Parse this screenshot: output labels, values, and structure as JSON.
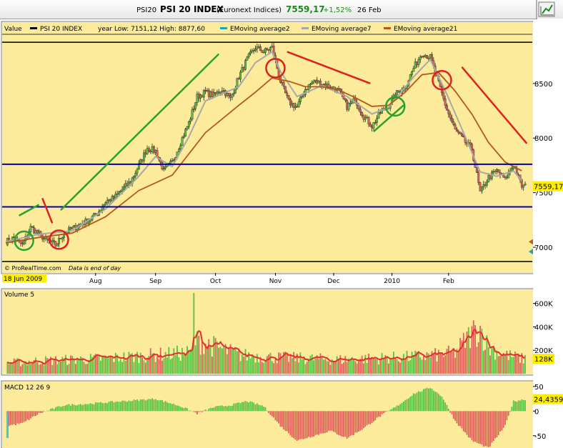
{
  "header": {
    "symbol": "PSI20",
    "name": "PSI 20 INDEX",
    "exchange": "(Euronext Indices)",
    "price": "7559,17",
    "change": "+1,52%",
    "date": "26 Feb"
  },
  "legend": {
    "value_label": "Value",
    "items": [
      {
        "label": "PSI 20 INDEX",
        "color": "#000000"
      },
      {
        "label": "year Low: 7151,12 High: 8877,60",
        "color": null
      },
      {
        "label": "EMoving average2",
        "color": "#1aa7b5"
      },
      {
        "label": "EMoving average7",
        "color": "#a8a8a8"
      },
      {
        "label": "EMoving average21",
        "color": "#b8561a"
      }
    ]
  },
  "footer": {
    "source": "© ProRealTime.com",
    "note": "Data is end of day",
    "start_date": "18 Jun 2009"
  },
  "colors": {
    "panel_bg": "#fbeb9a",
    "up": "#59c243",
    "down": "#e0605a",
    "blue_lines": "#0000b4",
    "trend_green": "#2aa12a",
    "trend_red": "#e02020",
    "ema21": "#b8561a",
    "ema7": "#a8a8a8",
    "volume_avg": "#e03030"
  },
  "chart_data": [
    {
      "type": "candlestick",
      "title": "PSI 20 INDEX",
      "y_ticks": [
        "7000",
        "7500",
        "8000",
        "8500"
      ],
      "ylim": [
        6850,
        8950
      ],
      "x_ticks": [
        "Aug",
        "Sep",
        "Oct",
        "Nov",
        "Dec",
        "2010",
        "Feb"
      ],
      "last_value_label": "7559,17",
      "horizontal_lines": [
        7760,
        7370
      ],
      "frame_lines": [
        8877.6,
        6870
      ],
      "series_close": [
        [
          0,
          7050
        ],
        [
          5,
          7090
        ],
        [
          10,
          7020
        ],
        [
          15,
          7180
        ],
        [
          20,
          7120
        ],
        [
          25,
          7060
        ],
        [
          30,
          7020
        ],
        [
          35,
          7130
        ],
        [
          40,
          7170
        ],
        [
          45,
          7210
        ],
        [
          50,
          7250
        ],
        [
          55,
          7310
        ],
        [
          60,
          7420
        ],
        [
          65,
          7450
        ],
        [
          70,
          7530
        ],
        [
          75,
          7600
        ],
        [
          80,
          7750
        ],
        [
          85,
          7910
        ],
        [
          90,
          7880
        ],
        [
          95,
          7700
        ],
        [
          100,
          7780
        ],
        [
          105,
          7960
        ],
        [
          110,
          8140
        ],
        [
          115,
          8380
        ],
        [
          120,
          8420
        ],
        [
          125,
          8390
        ],
        [
          130,
          8450
        ],
        [
          135,
          8360
        ],
        [
          140,
          8560
        ],
        [
          145,
          8720
        ],
        [
          150,
          8830
        ],
        [
          155,
          8790
        ],
        [
          160,
          8830
        ],
        [
          165,
          8520
        ],
        [
          170,
          8330
        ],
        [
          175,
          8280
        ],
        [
          180,
          8450
        ],
        [
          185,
          8520
        ],
        [
          190,
          8500
        ],
        [
          195,
          8470
        ],
        [
          200,
          8430
        ],
        [
          205,
          8290
        ],
        [
          210,
          8350
        ],
        [
          215,
          8200
        ],
        [
          220,
          8110
        ],
        [
          225,
          8230
        ],
        [
          230,
          8300
        ],
        [
          235,
          8410
        ],
        [
          240,
          8470
        ],
        [
          245,
          8640
        ],
        [
          250,
          8780
        ],
        [
          255,
          8740
        ],
        [
          260,
          8500
        ],
        [
          265,
          8260
        ],
        [
          270,
          8070
        ],
        [
          275,
          7980
        ],
        [
          280,
          7900
        ],
        [
          285,
          7500
        ],
        [
          290,
          7640
        ],
        [
          295,
          7700
        ],
        [
          300,
          7620
        ],
        [
          305,
          7760
        ],
        [
          310,
          7559
        ]
      ],
      "ema21": [
        [
          0,
          7040
        ],
        [
          20,
          7090
        ],
        [
          40,
          7130
        ],
        [
          60,
          7280
        ],
        [
          80,
          7520
        ],
        [
          100,
          7660
        ],
        [
          120,
          8050
        ],
        [
          140,
          8300
        ],
        [
          150,
          8420
        ],
        [
          160,
          8550
        ],
        [
          170,
          8520
        ],
        [
          180,
          8470
        ],
        [
          190,
          8470
        ],
        [
          200,
          8440
        ],
        [
          210,
          8370
        ],
        [
          220,
          8290
        ],
        [
          230,
          8300
        ],
        [
          240,
          8420
        ],
        [
          250,
          8580
        ],
        [
          260,
          8600
        ],
        [
          270,
          8430
        ],
        [
          280,
          8220
        ],
        [
          290,
          7960
        ],
        [
          300,
          7780
        ],
        [
          310,
          7700
        ]
      ],
      "ema7": [
        [
          0,
          7050
        ],
        [
          20,
          7120
        ],
        [
          40,
          7150
        ],
        [
          60,
          7350
        ],
        [
          80,
          7650
        ],
        [
          90,
          7830
        ],
        [
          100,
          7740
        ],
        [
          110,
          8010
        ],
        [
          120,
          8340
        ],
        [
          140,
          8470
        ],
        [
          150,
          8690
        ],
        [
          160,
          8790
        ],
        [
          165,
          8610
        ],
        [
          175,
          8380
        ],
        [
          190,
          8480
        ],
        [
          205,
          8380
        ],
        [
          220,
          8220
        ],
        [
          230,
          8280
        ],
        [
          245,
          8560
        ],
        [
          255,
          8720
        ],
        [
          265,
          8400
        ],
        [
          275,
          8050
        ],
        [
          285,
          7690
        ],
        [
          295,
          7650
        ],
        [
          305,
          7700
        ],
        [
          310,
          7610
        ]
      ],
      "trend_lines": [
        {
          "color": "green",
          "from": [
            8,
            7290
          ],
          "to": [
            20,
            7390
          ]
        },
        {
          "color": "red",
          "from": [
            22,
            7450
          ],
          "to": [
            28,
            7220
          ]
        },
        {
          "color": "green",
          "from": [
            33,
            7340
          ],
          "to": [
            128,
            8770
          ]
        },
        {
          "color": "red",
          "from": [
            169,
            8790
          ],
          "to": [
            219,
            8500
          ]
        },
        {
          "color": "green",
          "from": [
            221,
            8060
          ],
          "to": [
            239,
            8300
          ]
        },
        {
          "color": "red",
          "from": [
            274,
            8650
          ],
          "to": [
            313,
            7950
          ]
        }
      ],
      "circles": [
        {
          "color": "green",
          "center": [
            11,
            7060
          ]
        },
        {
          "color": "red",
          "center": [
            32,
            7070
          ]
        },
        {
          "color": "red",
          "center": [
            162,
            8640
          ]
        },
        {
          "color": "green",
          "center": [
            234,
            8290
          ]
        },
        {
          "color": "red",
          "center": [
            262,
            8530
          ]
        }
      ]
    },
    {
      "type": "bar",
      "title": "Volume 5",
      "y_ticks": [
        "200K",
        "400K",
        "600K"
      ],
      "last_value_label": "128K",
      "ylim": [
        0,
        720000
      ],
      "values_pattern": [
        [
          0,
          90000
        ],
        [
          20,
          110000
        ],
        [
          40,
          120000
        ],
        [
          60,
          130000
        ],
        [
          80,
          150000
        ],
        [
          100,
          170000
        ],
        [
          112,
          180000
        ],
        [
          113,
          690000
        ],
        [
          114,
          280000
        ],
        [
          120,
          260000
        ],
        [
          140,
          160000
        ],
        [
          160,
          140000
        ],
        [
          180,
          130000
        ],
        [
          200,
          120000
        ],
        [
          220,
          130000
        ],
        [
          240,
          140000
        ],
        [
          260,
          160000
        ],
        [
          270,
          180000
        ],
        [
          280,
          350000
        ],
        [
          285,
          390000
        ],
        [
          290,
          220000
        ],
        [
          300,
          160000
        ],
        [
          310,
          128000
        ]
      ]
    },
    {
      "type": "bar",
      "title": "MACD 12 26 9",
      "y_ticks": [
        "50",
        "0",
        "-50"
      ],
      "last_value_label": "24,4359",
      "ylim": [
        -75,
        60
      ]
    }
  ]
}
